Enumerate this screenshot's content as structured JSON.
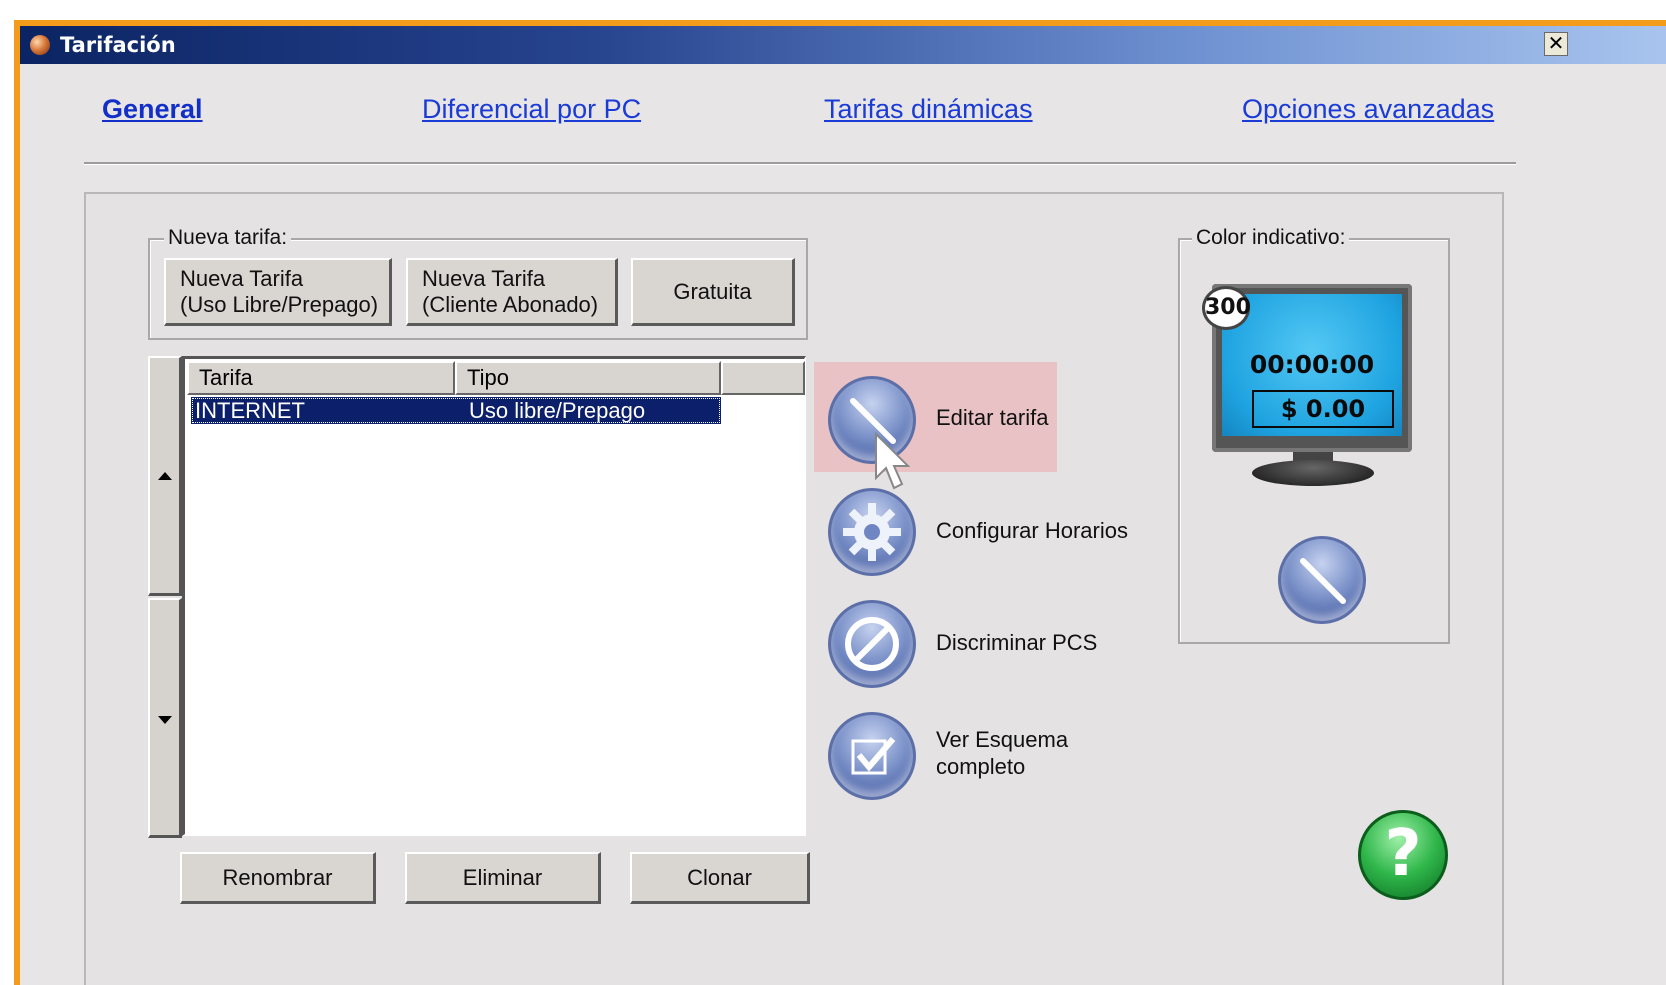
{
  "window": {
    "title": "Tarifación",
    "close_glyph": "✕"
  },
  "tabs": [
    {
      "label": "General"
    },
    {
      "label": "Diferencial por PC"
    },
    {
      "label": "Tarifas dinámicas"
    },
    {
      "label": "Opciones avanzadas"
    }
  ],
  "nueva_tarifa": {
    "legend": "Nueva tarifa:",
    "buttons": [
      {
        "line1": "Nueva Tarifa",
        "line2": "(Uso Libre/Prepago)"
      },
      {
        "line1": "Nueva Tarifa",
        "line2": "(Cliente Abonado)"
      },
      {
        "line1": "Gratuita",
        "line2": ""
      }
    ]
  },
  "list": {
    "columns": [
      "Tarifa",
      "Tipo"
    ],
    "rows": [
      {
        "tarifa": "INTERNET",
        "tipo": "Uso libre/Prepago",
        "selected": true
      }
    ]
  },
  "actions": [
    {
      "label": "Editar tarifa",
      "icon": "pencil-icon"
    },
    {
      "label": "Configurar Horarios",
      "icon": "gear-icon"
    },
    {
      "label": "Discriminar PCS",
      "icon": "prohibited-icon"
    },
    {
      "label_line1": "Ver Esquema",
      "label_line2": "completo",
      "icon": "checkmark-icon"
    }
  ],
  "bottom_buttons": {
    "rename": "Renombrar",
    "delete": "Eliminar",
    "clone": "Clonar"
  },
  "color_indicativo": {
    "legend": "Color indicativo:",
    "badge": "300",
    "time": "00:00:00",
    "price": "$ 0.00",
    "screen_color": "#1ea3e0"
  },
  "colors": {
    "title_start": "#0b2463",
    "title_end": "#a8c4ee",
    "selection": "#0c1f6a",
    "link": "#1a3bd6",
    "window_border": "#f39b1a"
  }
}
